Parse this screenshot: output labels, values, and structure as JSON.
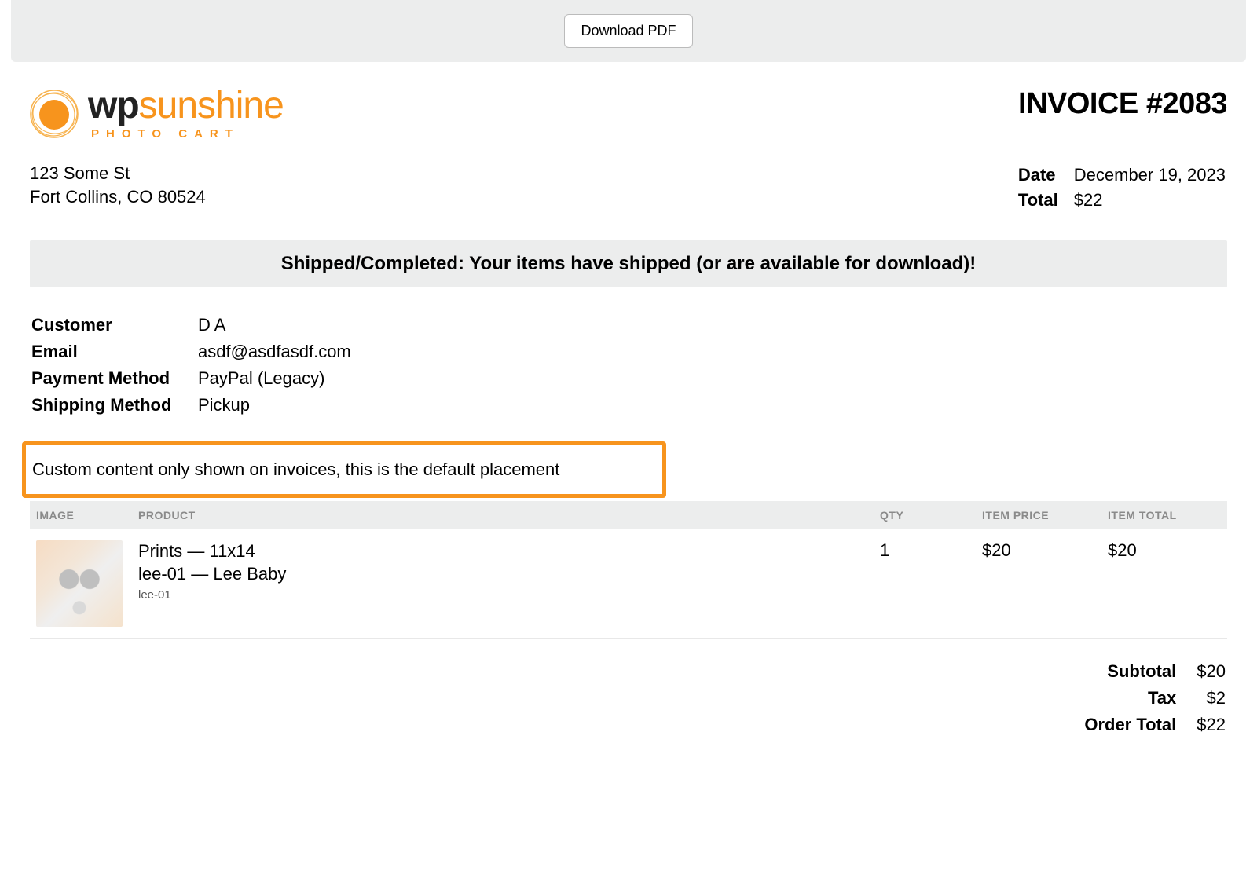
{
  "toolbar": {
    "download_label": "Download PDF"
  },
  "logo": {
    "line1_a": "wp",
    "line1_b": "sunshine",
    "line2": "PHOTO CART"
  },
  "invoice_title": "INVOICE #2083",
  "from_address": {
    "line1": "123 Some St",
    "line2": "Fort Collins, CO 80524"
  },
  "meta": {
    "date_label": "Date",
    "date_value": "December 19, 2023",
    "total_label": "Total",
    "total_value": "$22"
  },
  "status_banner": "Shipped/Completed: Your items have shipped (or are available for download)!",
  "customer_info": {
    "customer_label": "Customer",
    "customer_value": "D A",
    "email_label": "Email",
    "email_value": "asdf@asdfasdf.com",
    "payment_label": "Payment Method",
    "payment_value": "PayPal (Legacy)",
    "shipping_label": "Shipping Method",
    "shipping_value": "Pickup"
  },
  "custom_content": "Custom content only shown on invoices, this is the default placement",
  "items_table": {
    "headers": {
      "image": "IMAGE",
      "product": "PRODUCT",
      "qty": "QTY",
      "price": "ITEM PRICE",
      "total": "ITEM TOTAL"
    },
    "rows": [
      {
        "product_line1": "Prints — 11x14",
        "product_line2": "lee-01 — Lee Baby",
        "sku": "lee-01",
        "qty": "1",
        "price": "$20",
        "total": "$20"
      }
    ]
  },
  "totals": {
    "subtotal_label": "Subtotal",
    "subtotal_value": "$20",
    "tax_label": "Tax",
    "tax_value": "$2",
    "order_total_label": "Order Total",
    "order_total_value": "$22"
  }
}
